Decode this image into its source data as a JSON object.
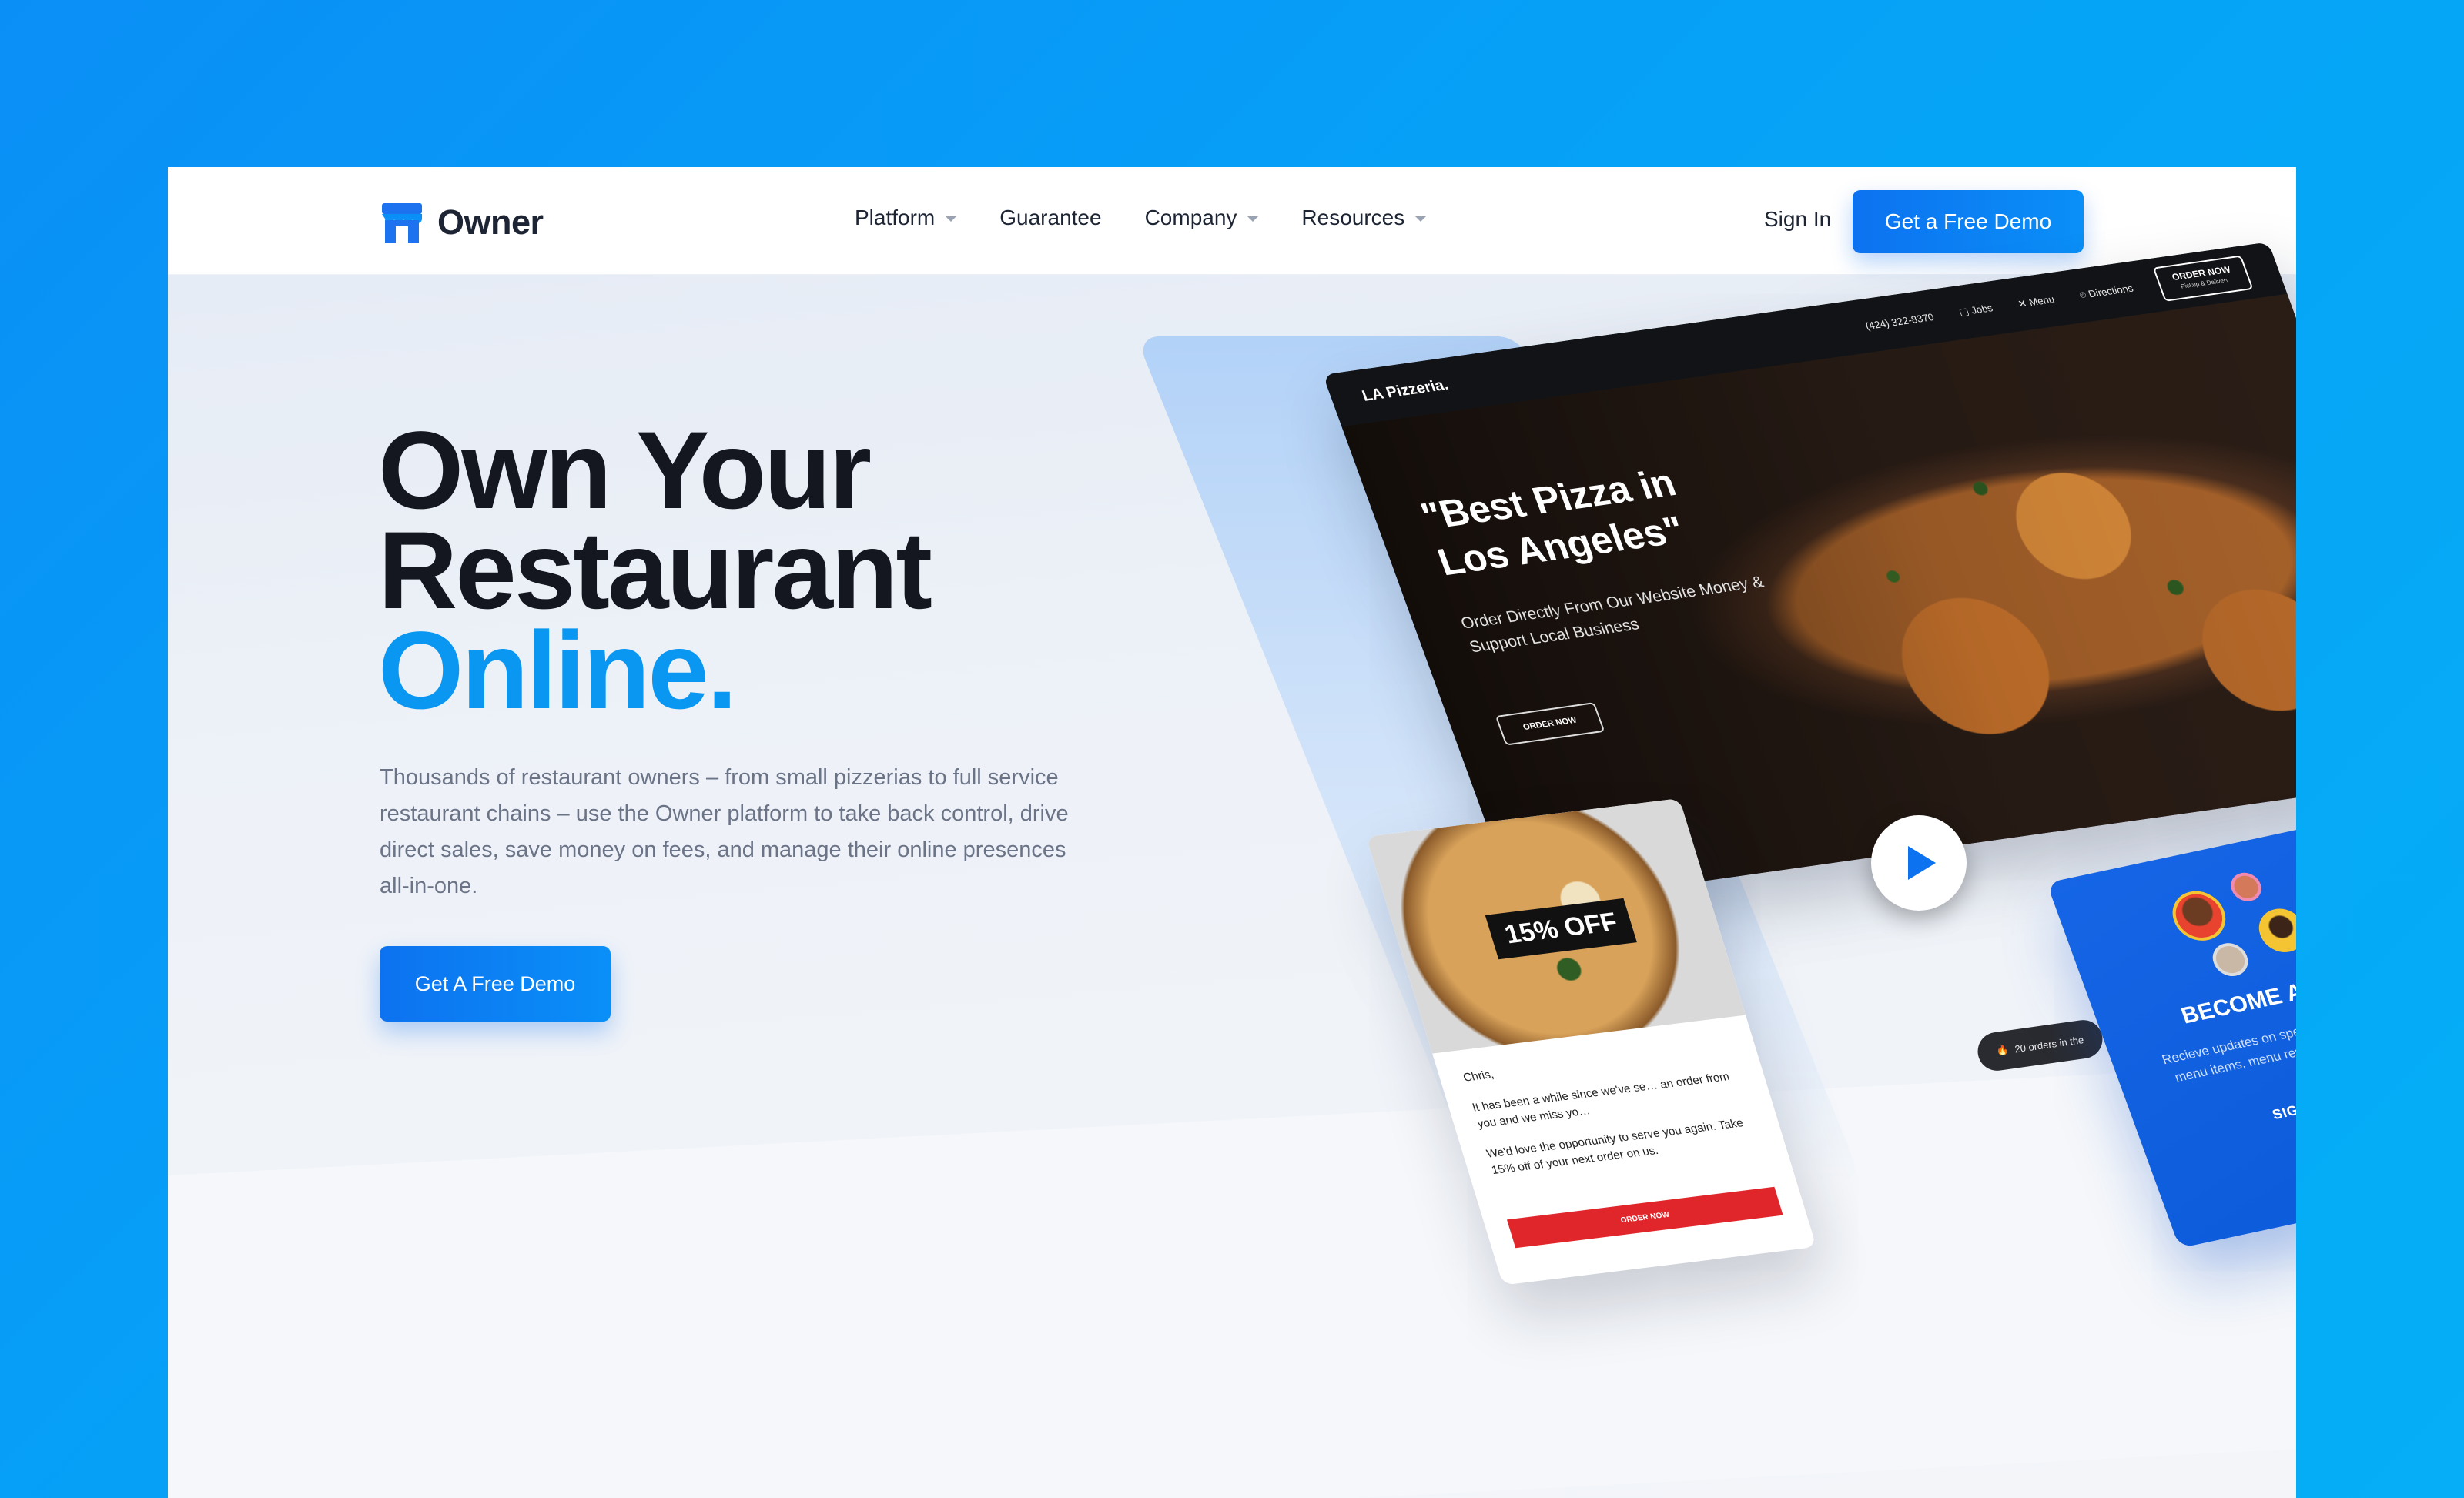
{
  "nav": {
    "brand": "Owner",
    "menu": [
      {
        "label": "Platform",
        "dropdown": true
      },
      {
        "label": "Guarantee",
        "dropdown": false
      },
      {
        "label": "Company",
        "dropdown": true
      },
      {
        "label": "Resources",
        "dropdown": true
      }
    ],
    "sign_in": "Sign In",
    "cta": "Get a Free Demo"
  },
  "hero": {
    "headline_line1": "Own Your",
    "headline_line2": "Restaurant",
    "headline_line3": "Online.",
    "description": "Thousands of restaurant owners – from small pizzerias to full service restaurant chains – use the Owner platform to take back control, drive direct sales, save money on fees, and manage their online presences all-in-one.",
    "cta": "Get A Free Demo"
  },
  "mockup": {
    "site": {
      "brand": "LA Pizzeria.",
      "phone": "(424) 322-8370",
      "links": [
        "Jobs",
        "Menu",
        "Directions"
      ],
      "order_now": "ORDER NOW",
      "order_now_sub": "Pickup & Delivery",
      "quote": "\"Best Pizza in Los Angeles\"",
      "sub_quote": "Order Directly From Our Website Money & Support Local Business",
      "order_button": "ORDER NOW",
      "orders_pill": "20 orders in the"
    },
    "email": {
      "badge": "15% OFF",
      "greeting": "Chris,",
      "line1": "It has been a while since we've se… an order from you and we miss yo…",
      "line2": "We'd love the opportunity to serve you again. Take 15% off of your next order on us.",
      "button": "ORDER NOW"
    },
    "vip": {
      "title": "BECOME A VIP",
      "text": "Recieve updates on special events, new menu items, menu reviews, and more!",
      "button": "SIGN UP"
    }
  },
  "colors": {
    "accent": "#0d72f0",
    "headline_blue": "#0a97f2",
    "page_bg": "#0a8ff6"
  }
}
